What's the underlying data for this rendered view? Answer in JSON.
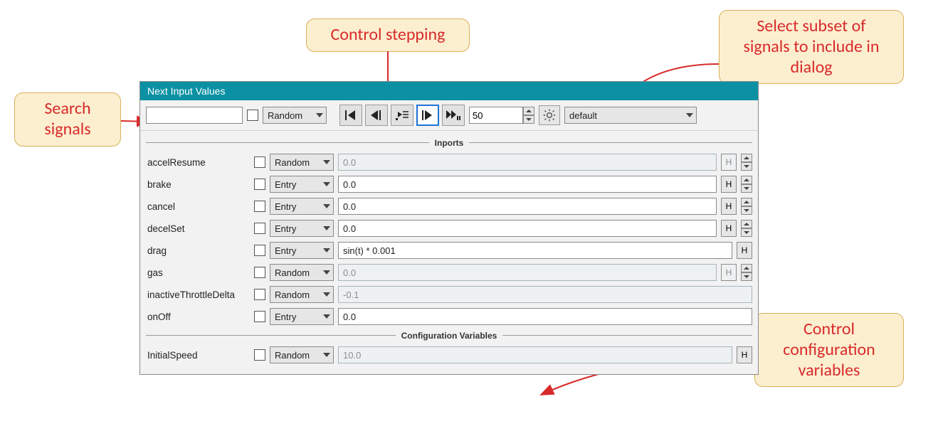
{
  "callouts": {
    "search": "Search signals",
    "stepping": "Control stepping",
    "subset": "Select subset of signals to include in dialog",
    "configvars": "Control configuration variables"
  },
  "dialog": {
    "title": "Next Input Values",
    "toolbar": {
      "search_value": "",
      "global_mode": "Random",
      "step_value": "50",
      "subset_value": "default"
    },
    "sections": {
      "inports_label": "Inports",
      "configvars_label": "Configuration Variables"
    },
    "inports": [
      {
        "name": "accelResume",
        "mode": "Random",
        "value": "0.0",
        "disabled": true,
        "h_disabled": true,
        "has_spin": true
      },
      {
        "name": "brake",
        "mode": "Entry",
        "value": "0.0",
        "disabled": false,
        "h_disabled": false,
        "has_spin": true
      },
      {
        "name": "cancel",
        "mode": "Entry",
        "value": "0.0",
        "disabled": false,
        "h_disabled": false,
        "has_spin": true
      },
      {
        "name": "decelSet",
        "mode": "Entry",
        "value": "0.0",
        "disabled": false,
        "h_disabled": false,
        "has_spin": true
      },
      {
        "name": "drag",
        "mode": "Entry",
        "value": "sin(t) * 0.001",
        "disabled": false,
        "h_disabled": false,
        "has_spin": false
      },
      {
        "name": "gas",
        "mode": "Random",
        "value": "0.0",
        "disabled": true,
        "h_disabled": true,
        "has_spin": true
      },
      {
        "name": "inactiveThrottleDelta",
        "mode": "Random",
        "value": "-0.1",
        "disabled": true,
        "h_disabled": true,
        "has_spin": false,
        "hide_h": true
      },
      {
        "name": "onOff",
        "mode": "Entry",
        "value": "0.0",
        "disabled": false,
        "h_disabled": false,
        "has_spin": false,
        "hide_h": true
      }
    ],
    "configvars": [
      {
        "name": "InitialSpeed",
        "mode": "Random",
        "value": "10.0",
        "disabled": true
      }
    ],
    "h_label": "H"
  }
}
